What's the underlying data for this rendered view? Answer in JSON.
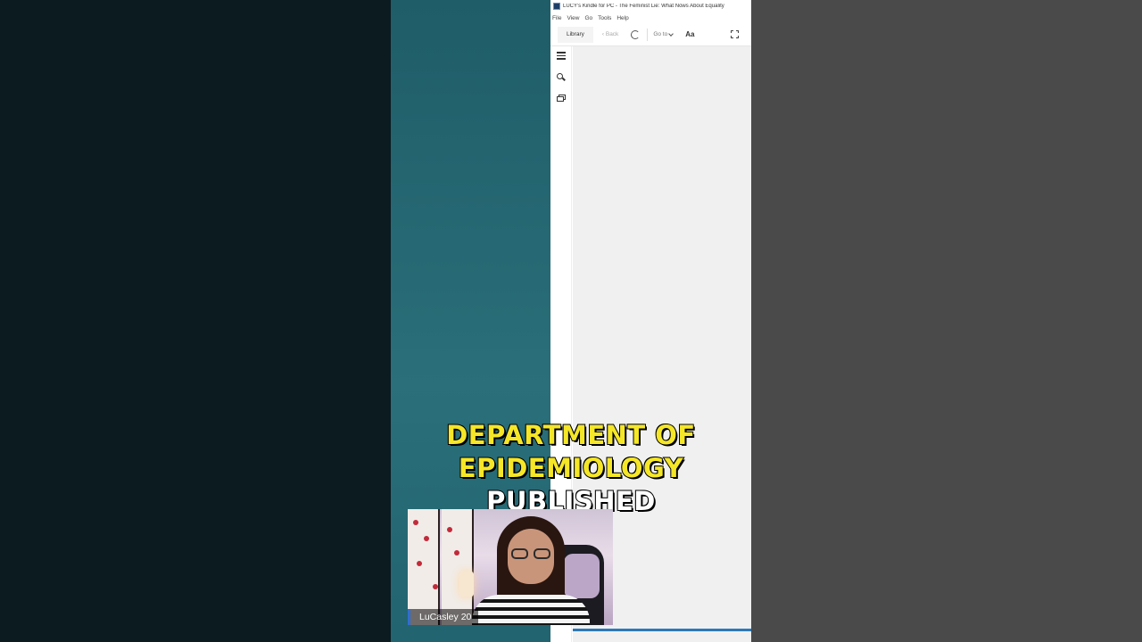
{
  "window": {
    "title": "LUCY's Kindle for PC - The Feminist Lie: What Nows About Equality",
    "icon": "kindle-app-icon"
  },
  "menu": [
    "File",
    "View",
    "Go",
    "Tools",
    "Help"
  ],
  "toolbar": {
    "library_label": "Library",
    "back_label": "Back",
    "goto_label": "Go to",
    "font_label": "Aa"
  },
  "sidebar": {
    "icons": [
      "table-of-contents-icon",
      "search-icon",
      "flashcards-icon"
    ]
  },
  "reading": {
    "progress_fraction": 1.0,
    "progress_color": "#2c79b8"
  },
  "caption": {
    "line1": "DEPARTMENT OF",
    "line2": "EPIDEMIOLOGY",
    "line3": "PUBLISHED",
    "highlight_color": "#f5e628",
    "plain_color": "#ffffff"
  },
  "webcam": {
    "name_tag": "LuCasley 20"
  },
  "colors": {
    "left_bg": "#0c1b1f",
    "teal_bg": "#226470",
    "right_bg": "#4a4a4a"
  }
}
